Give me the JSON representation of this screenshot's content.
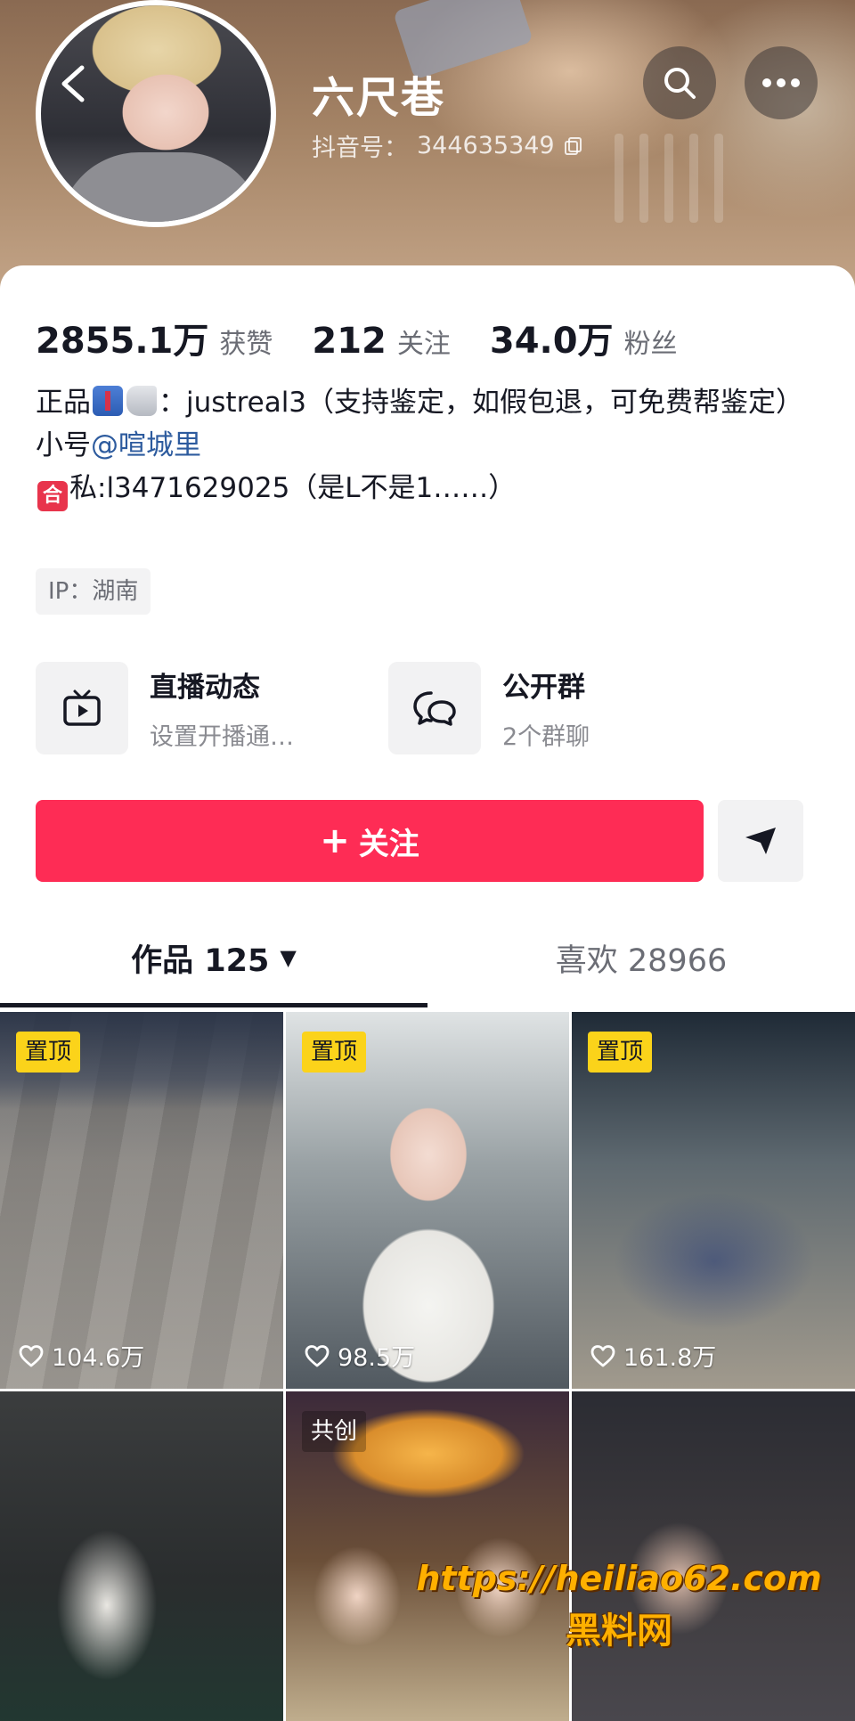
{
  "header": {
    "username": "六尺巷",
    "douyin_id_label": "抖音号：",
    "douyin_id": "344635349"
  },
  "stats": [
    {
      "value": "2855.1万",
      "label": "获赞"
    },
    {
      "value": "212",
      "label": "关注"
    },
    {
      "value": "34.0万",
      "label": "粉丝"
    }
  ],
  "bio": {
    "line1_prefix": "正品",
    "line1_text": "：justreal3（支持鉴定，如假包退，可免费帮鉴定）",
    "line2_prefix": "小号",
    "line2_link": "@喧城里",
    "line3_icon_text": "合",
    "line3_text": "私:l3471629025（是L不是1……）"
  },
  "ip": "IP：湖南",
  "features": [
    {
      "title": "直播动态",
      "subtitle": "设置开播通…"
    },
    {
      "title": "公开群",
      "subtitle": "2个群聊"
    }
  ],
  "actions": {
    "follow_plus": "+",
    "follow_label": "关注"
  },
  "tabs": {
    "works": "作品 125",
    "works_caret": "▼",
    "likes": "喜欢 28966"
  },
  "videos": [
    {
      "badge": "置顶",
      "likes": "104.6万"
    },
    {
      "badge": "置顶",
      "likes": "98.5万"
    },
    {
      "badge": "置顶",
      "likes": "161.8万"
    },
    {
      "badge": "",
      "likes": ""
    },
    {
      "badge": "共创",
      "likes": ""
    },
    {
      "badge": "",
      "likes": ""
    }
  ],
  "watermark": {
    "url": "https://heiliao62.com",
    "cn": "黑料网"
  },
  "colors": {
    "accent": "#fe2c55",
    "pin_badge": "#fbd31a",
    "link": "#2d5b9e"
  }
}
